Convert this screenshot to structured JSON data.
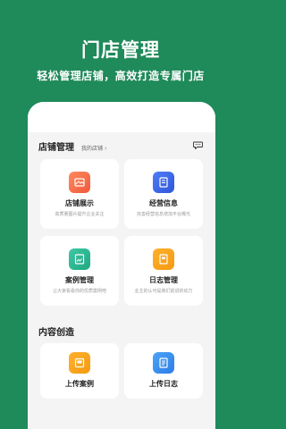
{
  "hero": {
    "title": "门店管理",
    "subtitle": "轻松管理店铺，高效打造专属门店"
  },
  "store_section": {
    "title": "店铺管理",
    "my_store_link": "我的店铺",
    "chevron": "›"
  },
  "cards": [
    {
      "title": "店铺展示",
      "desc": "高质量图片提升企业关注",
      "icon": "storefront-icon"
    },
    {
      "title": "经营信息",
      "desc": "完善经营信息增加平台曝光",
      "icon": "document-icon"
    },
    {
      "title": "案例管理",
      "desc": "让大家看看你的优质案例吧",
      "icon": "image-case-icon"
    },
    {
      "title": "日志管理",
      "desc": "业主的认可是我们前进的动力",
      "icon": "notebook-icon"
    }
  ],
  "content_section": {
    "title": "内容创造"
  },
  "content_cards": [
    {
      "title": "上传案例",
      "icon": "upload-case-icon"
    },
    {
      "title": "上传日志",
      "icon": "upload-log-icon"
    }
  ],
  "colors": {
    "background": "#1f8a5a",
    "orange": "#f0593c",
    "blue": "#2f56d9",
    "teal": "#1ea982",
    "amber": "#f49a10",
    "lightblue": "#2c7de8"
  }
}
